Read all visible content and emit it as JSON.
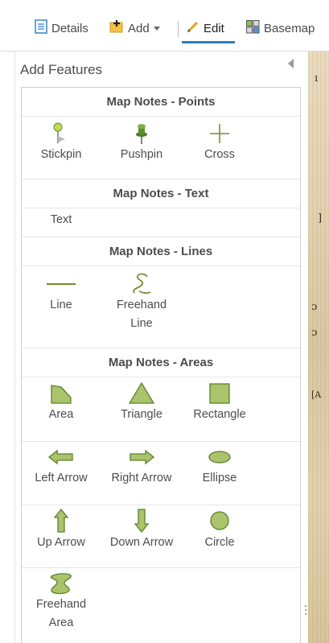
{
  "toolbar": {
    "details": "Details",
    "add": "Add",
    "edit": "Edit",
    "basemap": "Basemap",
    "active": "Edit"
  },
  "panel": {
    "title": "Add Features"
  },
  "sections": {
    "points": {
      "title": "Map Notes - Points",
      "items": {
        "stickpin": "Stickpin",
        "pushpin": "Pushpin",
        "cross": "Cross"
      }
    },
    "text": {
      "title": "Map Notes - Text",
      "items": {
        "text": "Text"
      }
    },
    "lines": {
      "title": "Map Notes - Lines",
      "items": {
        "line": "Line",
        "freehand_line_1": "Freehand",
        "freehand_line_2": "Line"
      }
    },
    "areas": {
      "title": "Map Notes - Areas",
      "items": {
        "area": "Area",
        "triangle": "Triangle",
        "rectangle": "Rectangle",
        "left_arrow": "Left Arrow",
        "right_arrow": "Right Arrow",
        "ellipse": "Ellipse",
        "up_arrow": "Up Arrow",
        "down_arrow": "Down Arrow",
        "circle": "Circle",
        "freehand_area_1": "Freehand",
        "freehand_area_2": "Area"
      }
    }
  },
  "colors": {
    "symbol_fill": "#a9c46a",
    "symbol_stroke": "#5f7f2d",
    "accent": "#2e7bbf"
  }
}
